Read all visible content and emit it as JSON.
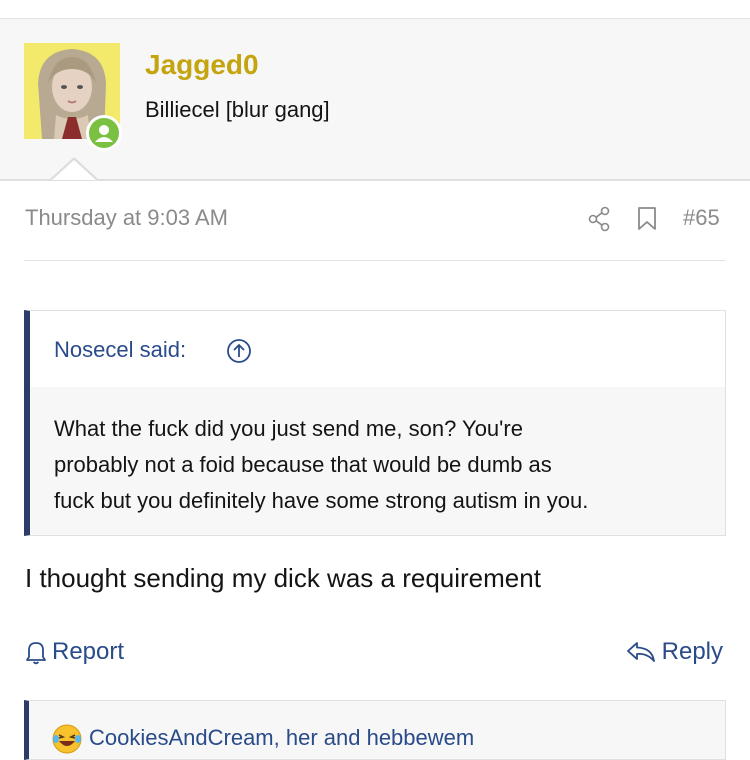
{
  "post": {
    "user": {
      "name": "Jagged0",
      "title": "Billiecel [blur gang]",
      "online": true
    },
    "date": "Thursday at 9:03 AM",
    "number": "#65",
    "quote": {
      "author": "Nosecel said:",
      "lines": [
        "What the fuck did you just send me, son? You're",
        "probably not a foid because that would be dumb as",
        "fuck but you definitely have some strong autism in you."
      ]
    },
    "text": "I thought sending my dick was a requirement",
    "actions": {
      "report": "Report",
      "reply": "Reply"
    },
    "reactions": {
      "users": "CookiesAndCream, her and hebbewem"
    }
  },
  "colors": {
    "username": "#c4a40f",
    "link": "#2a4b8a",
    "quote_border": "#2d3b69",
    "online": "#7ac142"
  },
  "icons": [
    "share-icon",
    "bookmark-icon",
    "arrow-up-circle-icon",
    "bell-icon",
    "reply-icon",
    "laughing-emoji-icon"
  ]
}
